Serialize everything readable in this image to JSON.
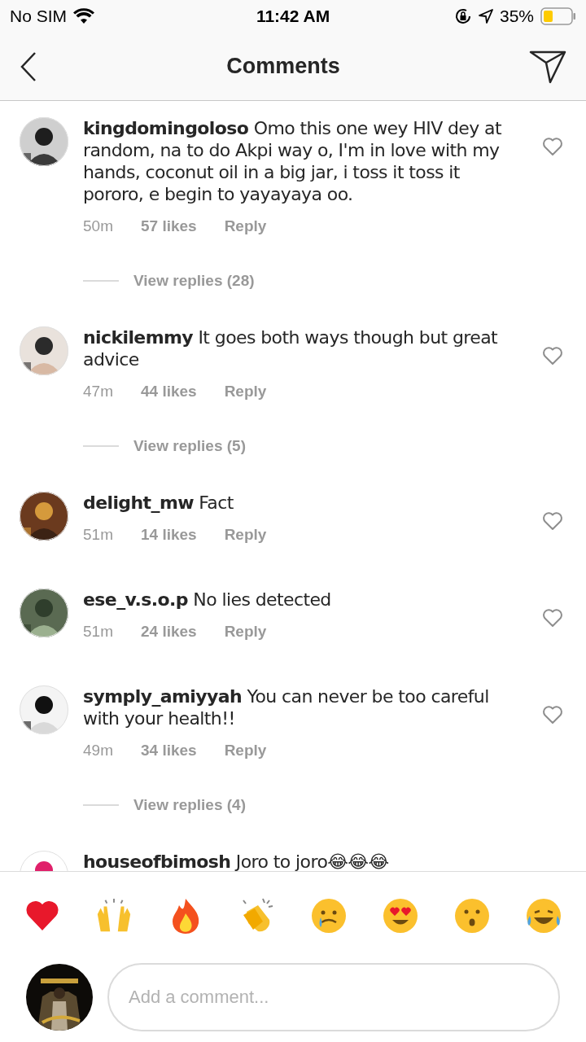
{
  "status_bar": {
    "carrier": "No SIM",
    "time": "11:42 AM",
    "battery": "35%"
  },
  "header": {
    "title": "Comments"
  },
  "comments": [
    {
      "username": "kingdomingoloso",
      "text": "Omo this one wey HIV dey at random, na to do Akpi way o, I'm in love with my hands, coconut oil in a big jar, i toss it toss it pororo, e begin to yayayaya oo.",
      "time": "50m",
      "likes": "57 likes",
      "reply": "Reply",
      "view_replies": "View replies (28)"
    },
    {
      "username": "nickilemmy",
      "text": "It goes both ways though but great advice",
      "time": "47m",
      "likes": "44 likes",
      "reply": "Reply",
      "view_replies": "View replies (5)"
    },
    {
      "username": "delight_mw",
      "text": "Fact",
      "time": "51m",
      "likes": "14 likes",
      "reply": "Reply"
    },
    {
      "username": "ese_v.s.o.p",
      "text": "No lies detected",
      "time": "51m",
      "likes": "24 likes",
      "reply": "Reply"
    },
    {
      "username": "symply_amiyyah",
      "text": "You can never be too careful with your health!!",
      "time": "49m",
      "likes": "34 likes",
      "reply": "Reply",
      "view_replies": "View replies (4)"
    },
    {
      "username": "houseofbimosh",
      "text": "Joro to joro😂😂😂"
    }
  ],
  "composer": {
    "placeholder": "Add a comment..."
  }
}
